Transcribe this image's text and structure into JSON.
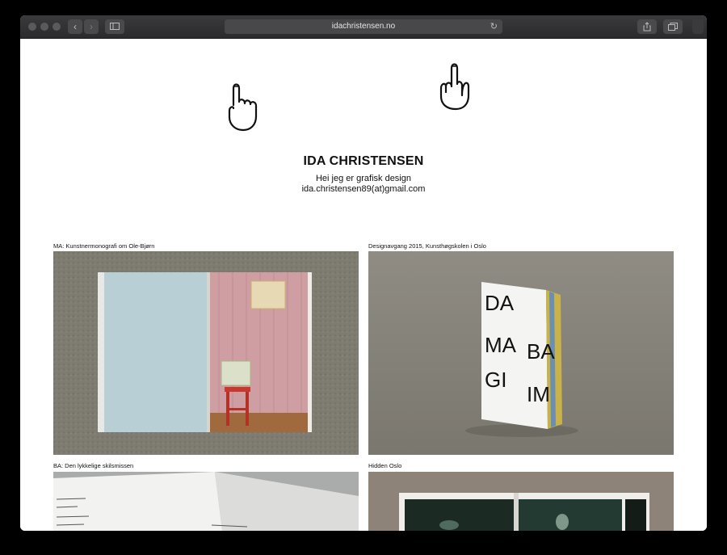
{
  "browser": {
    "url": "idachristensen.no",
    "back_icon": "chevron-left-icon",
    "forward_icon": "chevron-right-icon",
    "sidebar_icon": "sidebar-icon",
    "reload_icon": "reload-icon",
    "share_icon": "share-icon",
    "tabs_icon": "tabs-icon"
  },
  "header": {
    "name": "IDA CHRISTENSEN",
    "tagline": "Hei jeg er grafisk design",
    "email": "ida.christensen89(at)gmail.com"
  },
  "projects": [
    {
      "title": "MA: Kunstnermonografi om Ole-Bjørn"
    },
    {
      "title": "Designavgang 2015, Kunsthøgskolen i Oslo"
    },
    {
      "title": "BA: Den lykkelige skilsmissen"
    },
    {
      "title": "Hidden Oslo"
    }
  ],
  "book_cover_words": [
    "DA",
    "MA",
    "BA",
    "GI",
    "IM"
  ],
  "colors": {
    "toolbar": "#2e2e30",
    "background": "#ffffff",
    "text": "#111111"
  }
}
